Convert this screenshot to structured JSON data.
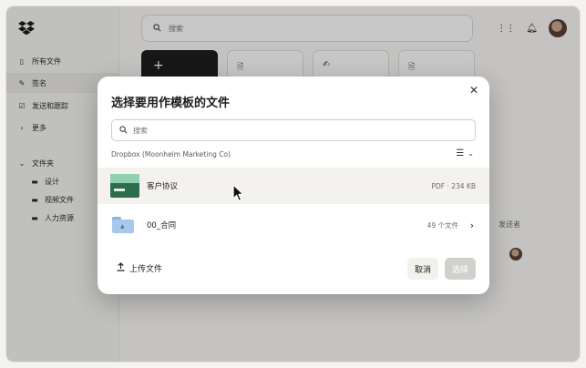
{
  "sidebar": {
    "items": [
      {
        "label": "所有文件",
        "icon": "files-icon"
      },
      {
        "label": "签名",
        "icon": "signature-icon"
      },
      {
        "label": "发送和跟踪",
        "icon": "send-track-icon"
      },
      {
        "label": "更多",
        "icon": "chevron-right-icon"
      }
    ],
    "section_label": "文件夹",
    "folders": [
      {
        "label": "设计"
      },
      {
        "label": "视频文件"
      },
      {
        "label": "人力资源"
      }
    ]
  },
  "header": {
    "search_placeholder": "搜索"
  },
  "background_table": {
    "column_sender": "发送者"
  },
  "modal": {
    "title": "选择要用作模板的文件",
    "search_placeholder": "搜索",
    "breadcrumb": "Dropbox (Moonhelm Marketing Co)",
    "files": [
      {
        "name": "客户协议",
        "meta": "PDF · 234 KB",
        "icon": "document-thumbnail"
      },
      {
        "name": "00_合同",
        "meta": "49 个文件",
        "icon": "folder-icon"
      }
    ],
    "upload_label": "上传文件",
    "cancel_label": "取消",
    "select_label": "选择"
  },
  "colors": {
    "primary_dark": "#1e1e1e",
    "disabled_button": "#d2d0cc",
    "selected_row": "#f4f2ee",
    "folder_blue": "#a9c8ec"
  }
}
